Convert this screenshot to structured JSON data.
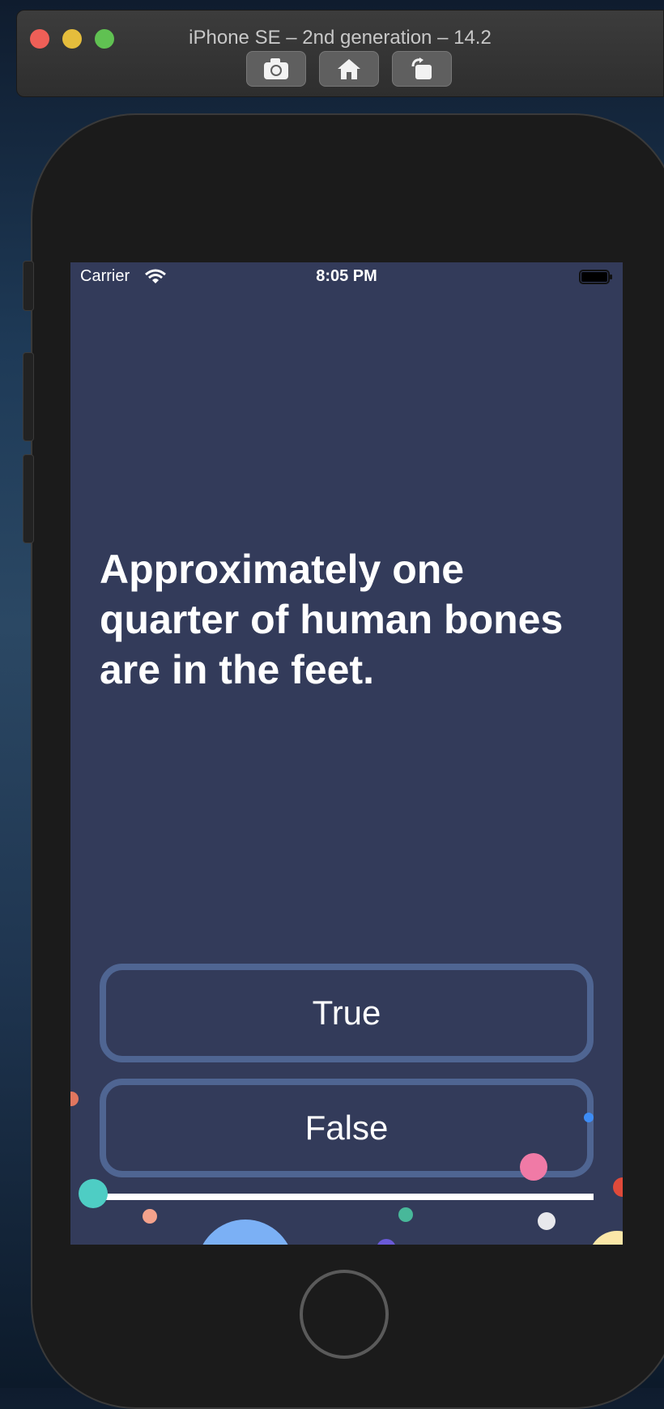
{
  "window": {
    "title": "iPhone SE – 2nd generation – 14.2",
    "toolbar": {
      "screenshot_icon": "camera-icon",
      "home_icon": "home-icon",
      "rotate_icon": "rotate-icon"
    }
  },
  "status_bar": {
    "carrier": "Carrier",
    "time": "8:05 PM"
  },
  "quiz": {
    "question": "Approximately one quarter of human bones are in the feet.",
    "answers": [
      "True",
      "False"
    ],
    "progress": 1.0
  },
  "colors": {
    "screen_background": "#333b5a",
    "button_border": "#4f6592",
    "text": "#ffffff"
  }
}
